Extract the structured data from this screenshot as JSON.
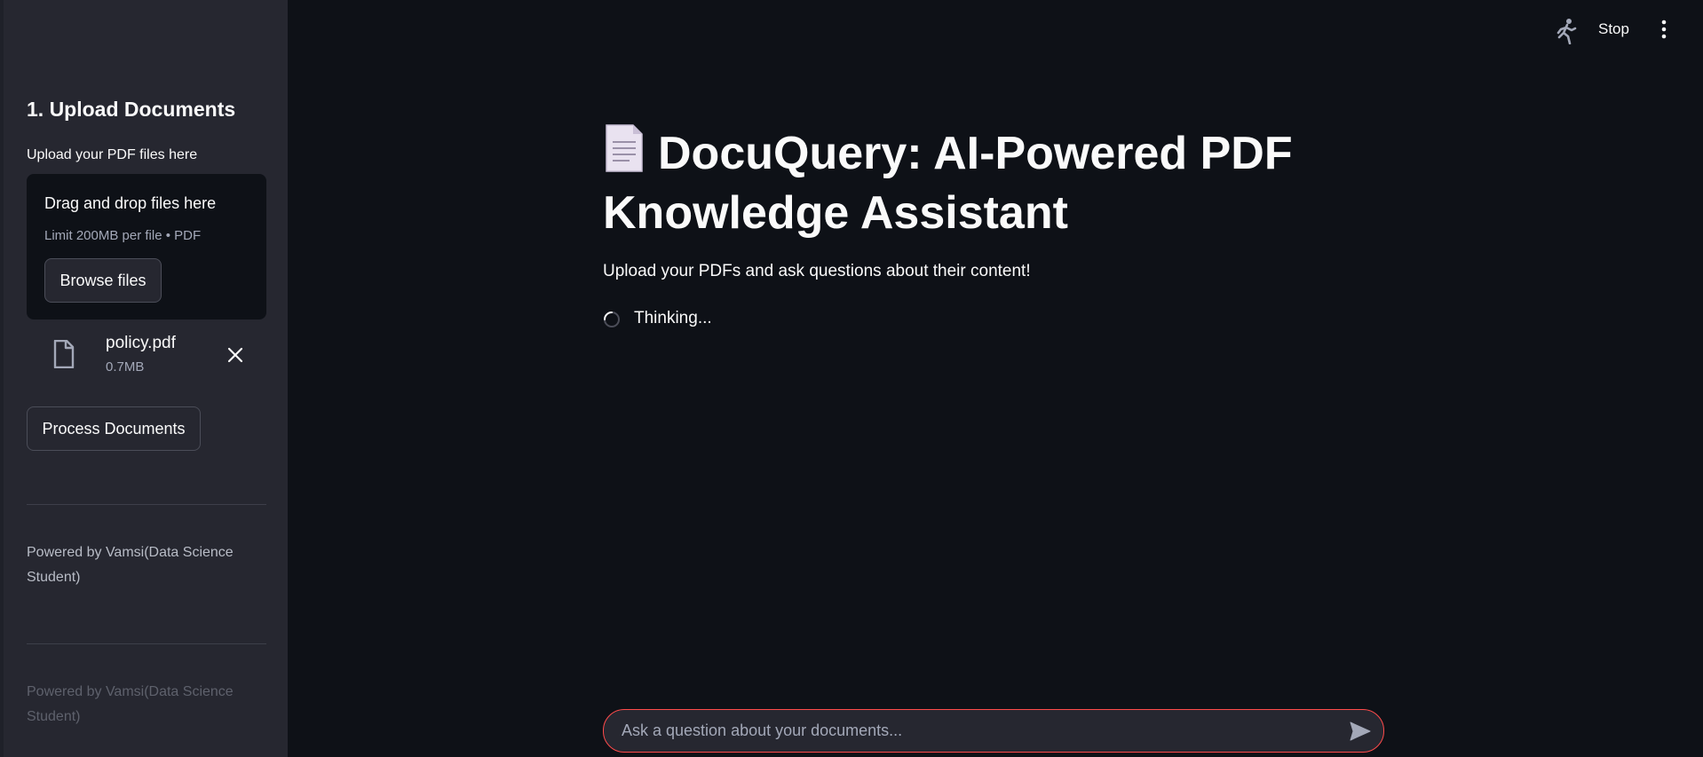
{
  "sidebar": {
    "header": "1. Upload Documents",
    "upload_label": "Upload your PDF files here",
    "dropzone": {
      "title": "Drag and drop files here",
      "limit": "Limit 200MB per file • PDF",
      "browse_label": "Browse files"
    },
    "file": {
      "name": "policy.pdf",
      "size": "0.7MB"
    },
    "process_label": "Process Documents",
    "powered_by": "Powered by Vamsi(Data Science Student)",
    "powered_by_faded": "Powered by Vamsi(Data Science Student)"
  },
  "topbar": {
    "stop_label": "Stop",
    "icons": [
      "running-man-icon",
      "kebab-menu-icon"
    ]
  },
  "main": {
    "title": "DocuQuery: AI-Powered PDF Knowledge Assistant",
    "title_emoji": "page-facing-up-icon",
    "subtitle": "Upload your PDFs and ask questions about their content!",
    "status": "Thinking..."
  },
  "chat": {
    "placeholder": "Ask a question about your documents..."
  },
  "colors": {
    "background": "#0e1117",
    "sidebar": "#262730",
    "accent": "#ff4b4b"
  }
}
